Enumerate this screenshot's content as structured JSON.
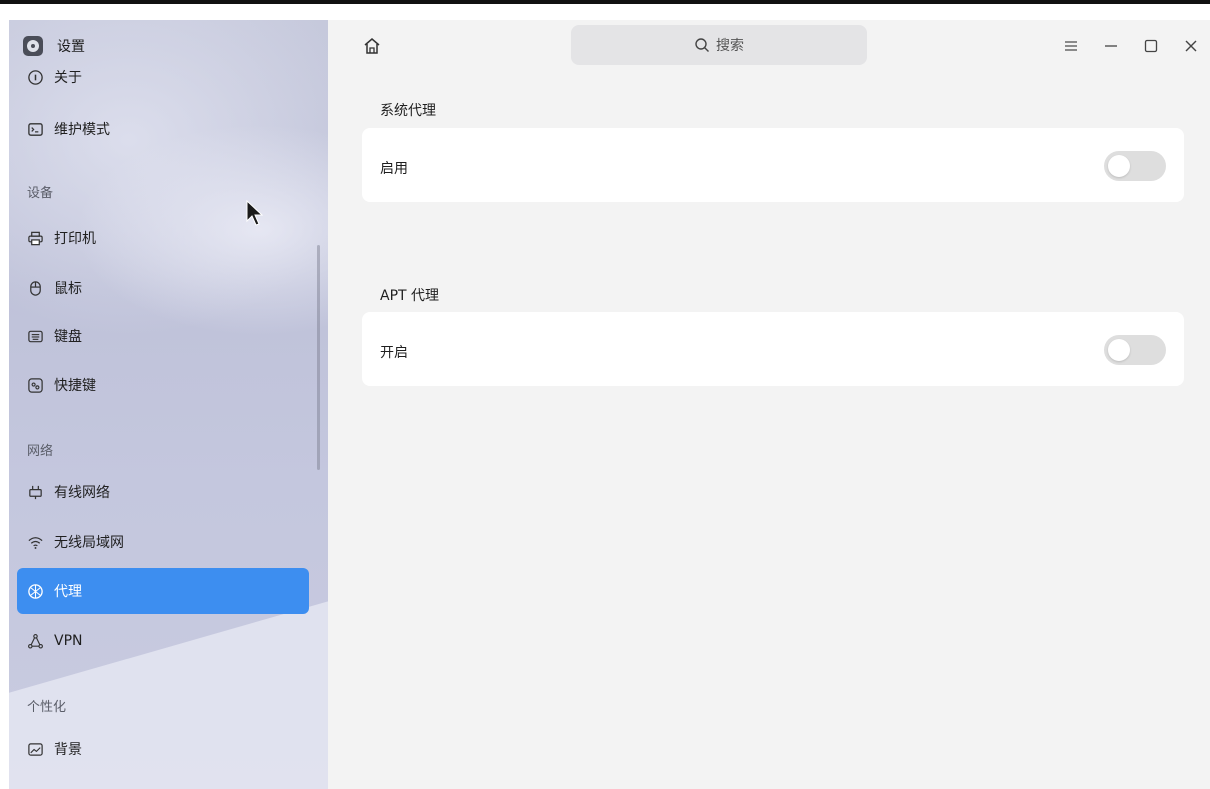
{
  "app": {
    "title": "设置"
  },
  "sidebar": {
    "items_top": [
      {
        "label": "关于",
        "icon": "info-icon"
      },
      {
        "label": "维护模式",
        "icon": "terminal-icon"
      }
    ],
    "section_devices": "设备",
    "devices": [
      {
        "label": "打印机",
        "icon": "printer-icon"
      },
      {
        "label": "鼠标",
        "icon": "mouse-icon"
      },
      {
        "label": "键盘",
        "icon": "keyboard-icon"
      },
      {
        "label": "快捷键",
        "icon": "shortcut-icon"
      }
    ],
    "section_network": "网络",
    "network": [
      {
        "label": "有线网络",
        "icon": "wired-network-icon"
      },
      {
        "label": "无线局域网",
        "icon": "wifi-icon"
      },
      {
        "label": "代理",
        "icon": "proxy-icon",
        "active": true
      },
      {
        "label": "VPN",
        "icon": "vpn-icon"
      }
    ],
    "section_personalize": "个性化",
    "personalize": [
      {
        "label": "背景",
        "icon": "background-icon"
      }
    ]
  },
  "header": {
    "search_placeholder": "搜索"
  },
  "content": {
    "system_proxy": {
      "title": "系统代理",
      "row_label": "启用",
      "enabled": false
    },
    "apt_proxy": {
      "title": "APT 代理",
      "row_label": "开启",
      "enabled": false
    }
  },
  "colors": {
    "accent": "#3d8ef0",
    "toggle_off": "#dedede",
    "card_bg": "#ffffff",
    "main_bg": "#f3f3f3"
  }
}
